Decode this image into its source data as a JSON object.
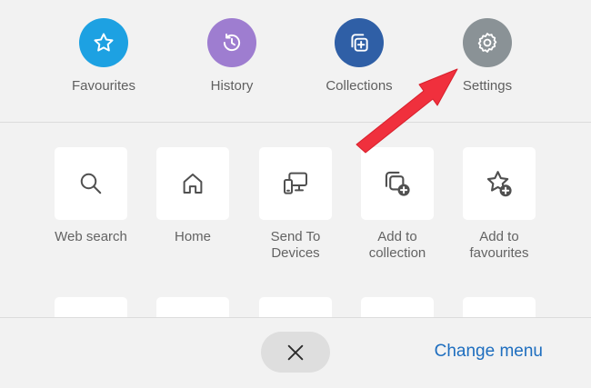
{
  "top_actions": [
    {
      "label": "Favourites",
      "icon": "star-icon",
      "color": "#1da1e2"
    },
    {
      "label": "History",
      "icon": "history-icon",
      "color": "#9e7dd0"
    },
    {
      "label": "Collections",
      "icon": "collections-icon",
      "color": "#2f5fa6"
    },
    {
      "label": "Settings",
      "icon": "gear-icon",
      "color": "#8a9296"
    }
  ],
  "grid_actions": [
    {
      "label": "Web search",
      "icon": "search-icon"
    },
    {
      "label": "Home",
      "icon": "home-icon"
    },
    {
      "label": "Send To\nDevices",
      "icon": "send-to-devices-icon"
    },
    {
      "label": "Add to\ncollection",
      "icon": "add-to-collection-icon"
    },
    {
      "label": "Add to\nfavourites",
      "icon": "add-to-favourites-icon"
    }
  ],
  "bottom_bar": {
    "close_icon": "close-icon",
    "change_menu_label": "Change menu"
  },
  "annotation": {
    "icon": "red-arrow-icon",
    "color": "#f0303d"
  }
}
